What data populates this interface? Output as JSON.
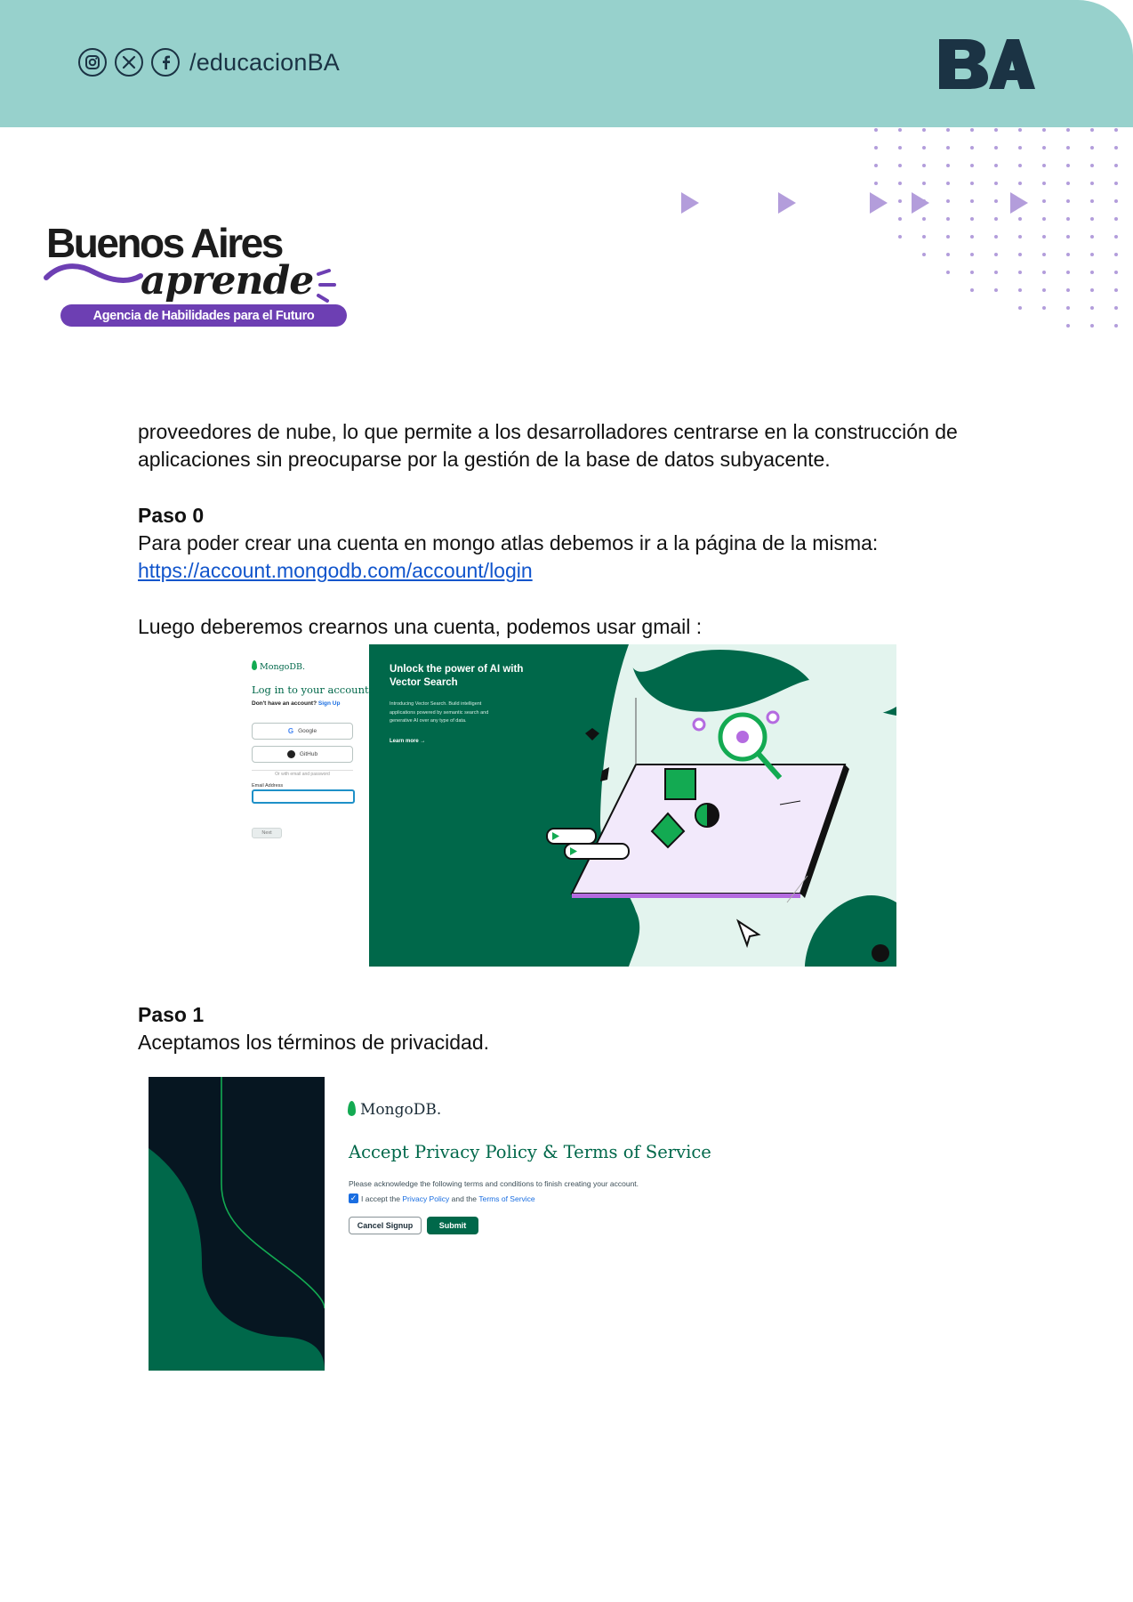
{
  "header": {
    "social_handle": "/educacionBA",
    "social_icons": [
      "instagram-icon",
      "x-twitter-icon",
      "facebook-icon"
    ],
    "logo_text": "BA",
    "colors": {
      "band": "#97d1cc",
      "ink": "#1b3344",
      "accent_purple": "#6d3fb3",
      "mongodb_green": "#00684a"
    }
  },
  "brand": {
    "line1": "Buenos Aires",
    "line2": "aprende",
    "tagline": "Agencia de Habilidades para el Futuro"
  },
  "body": {
    "intro_line1": "proveedores de nube, lo que permite a los desarrolladores centrarse en la construcción de",
    "intro_line2": "aplicaciones sin preocuparse por la gestión de la base de datos subyacente.",
    "step0_heading": "Paso 0",
    "step0_text": "Para poder crear una cuenta en mongo atlas debemos ir a la página de la misma:",
    "step0_link": "https://account.mongodb.com/account/login",
    "step0_after": "Luego deberemos crearnos una cuenta, podemos usar gmail :",
    "step1_heading": "Paso 1",
    "step1_text": "Aceptamos los términos de privacidad."
  },
  "login_screenshot": {
    "brand": "MongoDB.",
    "title": "Log in to your account",
    "signup_prompt": "Don't have an account?",
    "signup_link": "Sign Up",
    "google_label": "Google",
    "github_label": "GitHub",
    "divider": "Or with email and password",
    "email_label": "Email Address",
    "next_label": "Next",
    "promo_title": "Unlock the power of AI with Vector Search",
    "promo_text": "Introducing Vector Search. Build intelligent applications powered by semantic search and generative AI over any type of data.",
    "promo_link": "Learn more →"
  },
  "privacy_screenshot": {
    "brand": "MongoDB.",
    "title": "Accept Privacy Policy & Terms of Service",
    "note": "Please acknowledge the following terms and conditions to finish creating your account.",
    "check_prefix": "I accept the",
    "privacy_link": "Privacy Policy",
    "check_and": "and the",
    "terms_link": "Terms of Service",
    "cancel_label": "Cancel Signup",
    "submit_label": "Submit"
  }
}
